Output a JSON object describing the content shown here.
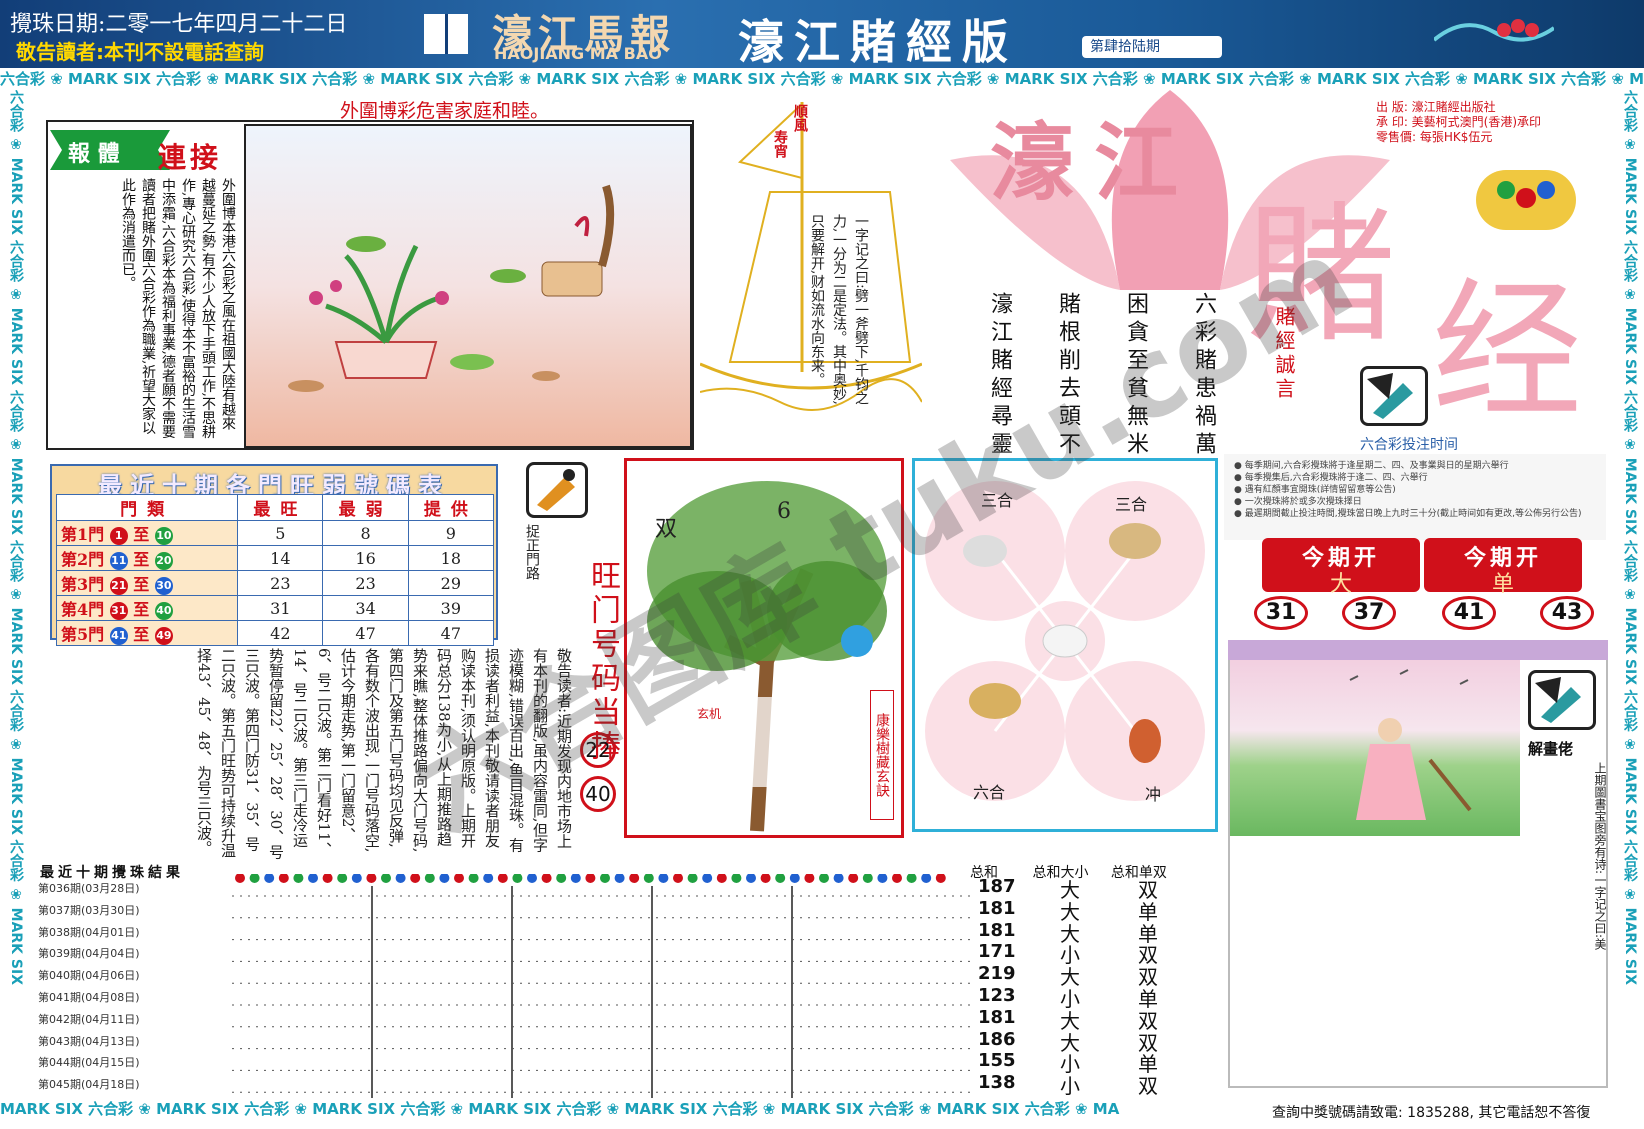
{
  "header": {
    "date": "攪珠日期:二零一七年四月二十二日",
    "notice": "敬告讀者:本刊不設電話查詢",
    "logo_cn": "濠江馬報",
    "logo_en": "HAOJIANG MA BAO",
    "edition": "濠江賭經版",
    "issue": "第肆拾陆期"
  },
  "ribbon": {
    "text": "六合彩 ❀ MARK SIX 六合彩 ❀ MARK SIX 六合彩 ❀ MARK SIX 六合彩 ❀ MARK SIX 六合彩 ❀ MARK SIX 六合彩 ❀ MARK SIX 六合彩 ❀ MARK SIX 六合彩 ❀ MARK SIX 六合彩 ❀ MARK SIX 六合彩 ❀ MARK SIX 六合彩 ❀ MARK SIX",
    "bottom": "MARK SIX 六合彩 ❀ MARK SIX 六合彩 ❀ MARK SIX 六合彩 ❀ MARK SIX 六合彩 ❀ MARK SIX 六合彩 ❀ MARK SIX 六合彩 ❀ MARK SIX 六合彩 ❀ MA",
    "vertical": "六合彩 ❀ MARK SIX 六合彩 ❀ MARK SIX 六合彩 ❀ MARK SIX 六合彩 ❀ MARK SIX 六合彩 ❀ MARK SIX 六合彩 ❀ MARK SIX"
  },
  "left_panel": {
    "headline": "外圍博彩危害家庭和睦。",
    "badge": "報 體",
    "connect": "連接",
    "article": "外圍博本港六合彩之風在祖國大陸有越來越蔓延之勢,有不少人放下手頭工作,不思耕作,專心研究六合彩,使得本不富裕的生活雪中添霜,六合彩本為福利事業,德者願不需要讀者把賭外圍六合彩作為職業,祈望大家以此作為消遣而已。"
  },
  "ship": {
    "flag": "順風",
    "flag2": "寿宵",
    "quote": "一字记之曰:劈一斧劈下,千钧之力,一分为二是定法。其中奥妙,只要解开,财如流水向东来。"
  },
  "poems": [
    "六彩賭患禍萬家",
    "困貪至貧無米炊",
    "賭根削去頭不回",
    "濠江賭經尋靈碼"
  ],
  "masthead": {
    "title1": "濠江",
    "title2": "賭",
    "title3": "经",
    "motto": "賭經誠言",
    "pub_lines": [
      "出  版: 濠江賭經出版社",
      "承  印: 美藝柯式澳門(香港)承印",
      "零售價: 每張HK$伍元"
    ],
    "bet_time_title": "六合彩投注时间",
    "bet_time_lines": [
      "● 每季期间,六合彩攪珠將于逢星期二、四、及事業與日的星期六舉行",
      "● 每季攪集后,六合彩攪珠將于逢二、四、六舉行",
      "● 遇有紅顏事宜開珠(詳情留留意等公告)",
      "● 一次攪珠將於或多次攪珠擇日",
      "● 最遲期間截止投注時間,攪珠當日晚上九时三十分(截止時间如有更改,等公佈另行公告)"
    ]
  },
  "sw_table": {
    "title": "最近十期各門旺弱號碼表",
    "headers": [
      "門類",
      "最旺",
      "最弱",
      "提供"
    ],
    "rows": [
      {
        "gate": "第1門",
        "a": "1",
        "b": "10",
        "max": "5",
        "min": "8",
        "give": "9"
      },
      {
        "gate": "第2門",
        "a": "11",
        "b": "20",
        "max": "14",
        "min": "16",
        "give": "18"
      },
      {
        "gate": "第3門",
        "a": "21",
        "b": "30",
        "max": "23",
        "min": "23",
        "give": "29"
      },
      {
        "gate": "第4門",
        "a": "31",
        "b": "40",
        "max": "31",
        "min": "34",
        "give": "39"
      },
      {
        "gate": "第5門",
        "a": "41",
        "b": "49",
        "max": "42",
        "min": "47",
        "give": "47"
      }
    ],
    "to": "至"
  },
  "notes": {
    "path_label": "捉正門路",
    "col1": "敬告读者:近期发现内地市场上有本刊的翻版,虽内容雷同,但字迹模糊,错误百出,鱼目混珠。有损读者利益,本刊敬请读者朋友购读本刊,须认明原版。上期开码总分138为小,从上期推路趋势来瞧,整体推路偏向大门号码,第四门及第五门号码均见反弹,各有数个波出现,一门号码落空,估计今期走势,第一门留意2、6、号二只波。第二门看好11、14、号二只波。第三门走冷运势暂停留22、25、28、30、号三只波。第四门防31、35、号二只波。第五门旺势可持续升温择43、45、48、为号三只波。",
    "gate_title": "旺门号码当捧",
    "gate_balls": [
      "22",
      "40"
    ]
  },
  "tree": {
    "side": "康樂樹藏玄訣",
    "label1": "双",
    "label2": "6",
    "caption": "玄机"
  },
  "zodiac": {
    "labels": [
      "三合",
      "三合",
      "六合",
      "冲"
    ]
  },
  "open": [
    {
      "title": "今期开",
      "value": "大"
    },
    {
      "title": "今期开",
      "value": "单"
    }
  ],
  "open_balls": [
    "31",
    "37",
    "41",
    "43"
  ],
  "riddle": {
    "label": "解畫佬",
    "text": "上期圖書宝图旁有诗:一字记之曰:美"
  },
  "results": {
    "title": "最近十期攪珠結果",
    "headers": [
      "总和",
      "总和大小",
      "总和单双"
    ],
    "rows": [
      {
        "label": "第036期(03月28日)",
        "sum": "187",
        "bs": "大",
        "oe": "双"
      },
      {
        "label": "第037期(03月30日)",
        "sum": "181",
        "bs": "大",
        "oe": "单"
      },
      {
        "label": "第038期(04月01日)",
        "sum": "181",
        "bs": "大",
        "oe": "单"
      },
      {
        "label": "第039期(04月04日)",
        "sum": "171",
        "bs": "小",
        "oe": "双"
      },
      {
        "label": "第040期(04月06日)",
        "sum": "219",
        "bs": "大",
        "oe": "双"
      },
      {
        "label": "第041期(04月08日)",
        "sum": "123",
        "bs": "小",
        "oe": "单"
      },
      {
        "label": "第042期(04月11日)",
        "sum": "181",
        "bs": "大",
        "oe": "双"
      },
      {
        "label": "第043期(04月13日)",
        "sum": "186",
        "bs": "大",
        "oe": "双"
      },
      {
        "label": "第044期(04月15日)",
        "sum": "155",
        "bs": "小",
        "oe": "单"
      },
      {
        "label": "第045期(04月18日)",
        "sum": "138",
        "bs": "小",
        "oe": "双"
      }
    ]
  },
  "footer": {
    "contact": "查詢中獎號碼請致電: 1835288, 其它電話恕不答復"
  },
  "watermark": "六合图库 tuku.com",
  "colors": {
    "red": "#d0101a",
    "blue": "#2fb0d8",
    "pink": "#f2a7b8"
  }
}
